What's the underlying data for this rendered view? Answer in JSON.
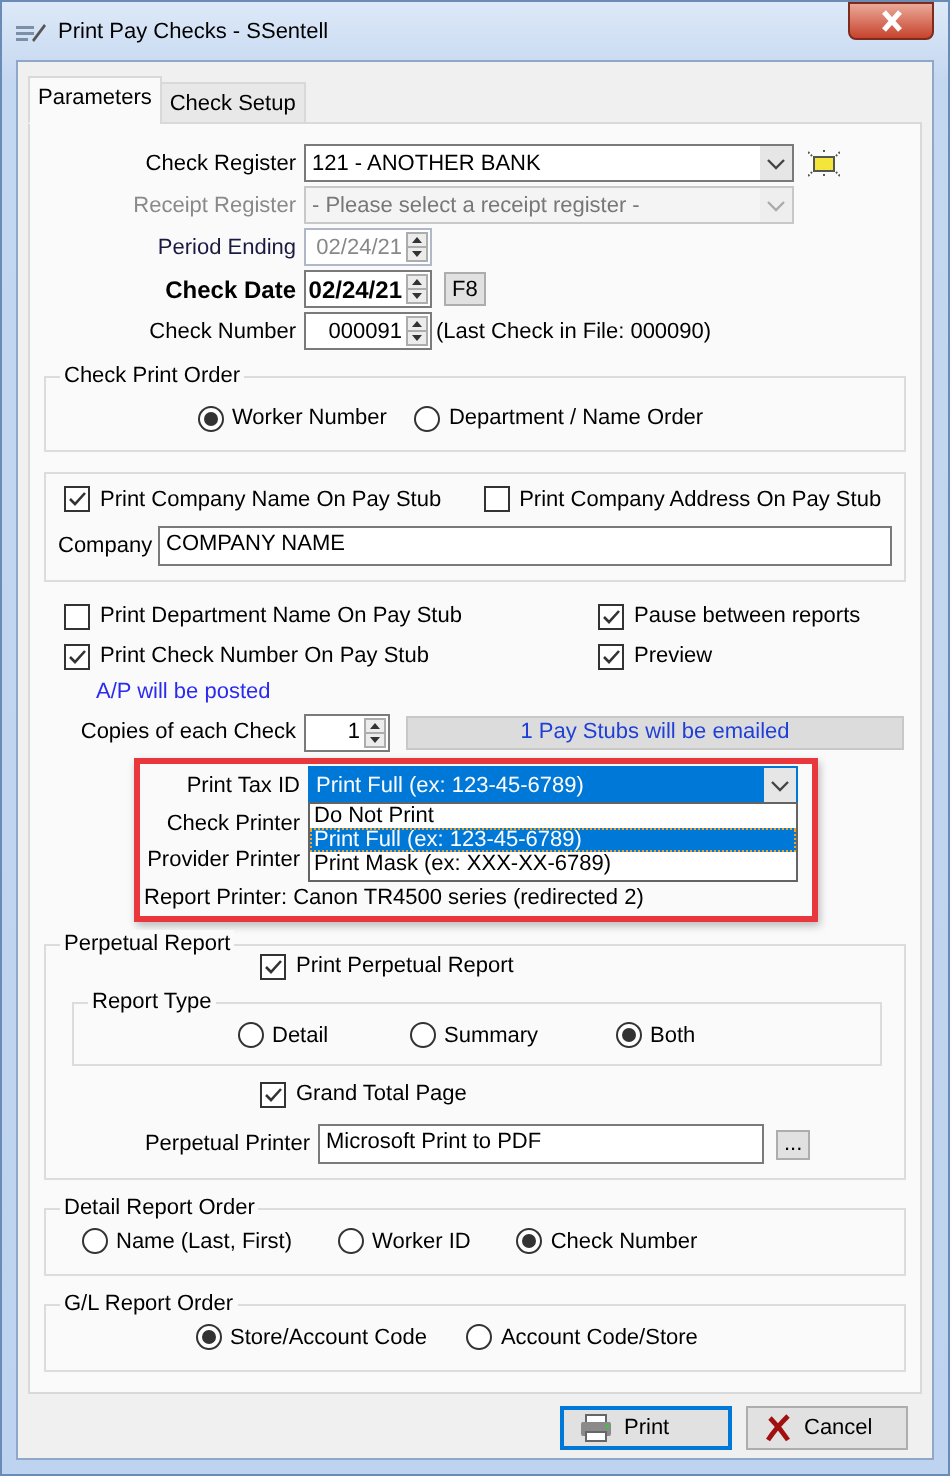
{
  "window": {
    "title": "Print Pay Checks - SSentell"
  },
  "tabs": [
    {
      "label": "Parameters",
      "selected": true
    },
    {
      "label": "Check Setup",
      "selected": false
    }
  ],
  "fields": [
    {
      "kind": "combo",
      "label": "Check Register",
      "value": "121 - ANOTHER BANK",
      "disabled": false,
      "bold": false,
      "lookup": true
    },
    {
      "kind": "combo",
      "label": "Receipt Register",
      "placeholder": "- Please select a receipt register -",
      "disabled": true,
      "bold": false
    },
    {
      "kind": "spin",
      "label": "Period Ending",
      "value": "02/24/21",
      "disabled": true,
      "bold": false
    },
    {
      "kind": "spin",
      "label": "Check Date",
      "value": "02/24/21",
      "disabled": false,
      "bold": true,
      "button": "F8"
    },
    {
      "kind": "spin",
      "label": "Check Number",
      "value": "000091",
      "disabled": false,
      "bold": false,
      "note": "(Last Check in File: 000090)"
    }
  ],
  "check_print_order": {
    "title": "Check Print Order",
    "options": [
      {
        "label": "Worker Number",
        "selected": true
      },
      {
        "label": "Department / Name Order",
        "selected": false
      }
    ]
  },
  "company": {
    "options": [
      {
        "label": "Print Company Name On Pay Stub",
        "checked": true
      },
      {
        "label": "Print Company Address On Pay Stub",
        "checked": false
      }
    ],
    "label": "Company",
    "value": "COMPANY NAME"
  },
  "options": [
    {
      "label": "Print Department Name On Pay Stub",
      "checked": false
    },
    {
      "label": "Pause between reports",
      "checked": true
    },
    {
      "label": "Print Check Number On Pay Stub",
      "checked": true
    },
    {
      "label": "Preview",
      "checked": true
    }
  ],
  "ap_note": "A/P will be posted",
  "copies": {
    "label": "Copies of each Check",
    "value": "1"
  },
  "email_status": "1 Pay Stubs will be emailed",
  "tax_id": {
    "label": "Print Tax ID",
    "value": "Print Full (ex: 123-45-6789)",
    "expanded": true,
    "highlighted": true,
    "options": [
      {
        "label": "Do Not Print",
        "selected": false
      },
      {
        "label": "Print Full (ex: 123-45-6789)",
        "selected": true
      },
      {
        "label": "Print Mask (ex: XXX-XX-6789)",
        "selected": false
      }
    ]
  },
  "printer_labels": [
    "Check Printer",
    "Provider Printer"
  ],
  "report_printer": "Report Printer: Canon TR4500 series (redirected 2)",
  "perpetual_report": {
    "title": "Perpetual Report",
    "print": {
      "label": "Print Perpetual Report",
      "checked": true
    },
    "report_type": {
      "title": "Report Type",
      "options": [
        {
          "label": "Detail",
          "selected": false
        },
        {
          "label": "Summary",
          "selected": false
        },
        {
          "label": "Both",
          "selected": true
        }
      ]
    },
    "grand_total": {
      "label": "Grand Total Page",
      "checked": true
    },
    "printer": {
      "label": "Perpetual Printer",
      "value": "Microsoft Print to PDF",
      "browse": "..."
    }
  },
  "detail_report_order": {
    "title": "Detail Report Order",
    "options": [
      {
        "label": "Name (Last, First)",
        "selected": false
      },
      {
        "label": "Worker ID",
        "selected": false
      },
      {
        "label": "Check Number",
        "selected": true
      }
    ]
  },
  "gl_report_order": {
    "title": "G/L Report Order",
    "options": [
      {
        "label": "Store/Account Code",
        "selected": true
      },
      {
        "label": "Account Code/Store",
        "selected": false
      }
    ]
  },
  "buttons": [
    {
      "kind": "print",
      "label": "Print",
      "focused": true
    },
    {
      "kind": "cancel",
      "label": "Cancel",
      "focused": false
    }
  ]
}
